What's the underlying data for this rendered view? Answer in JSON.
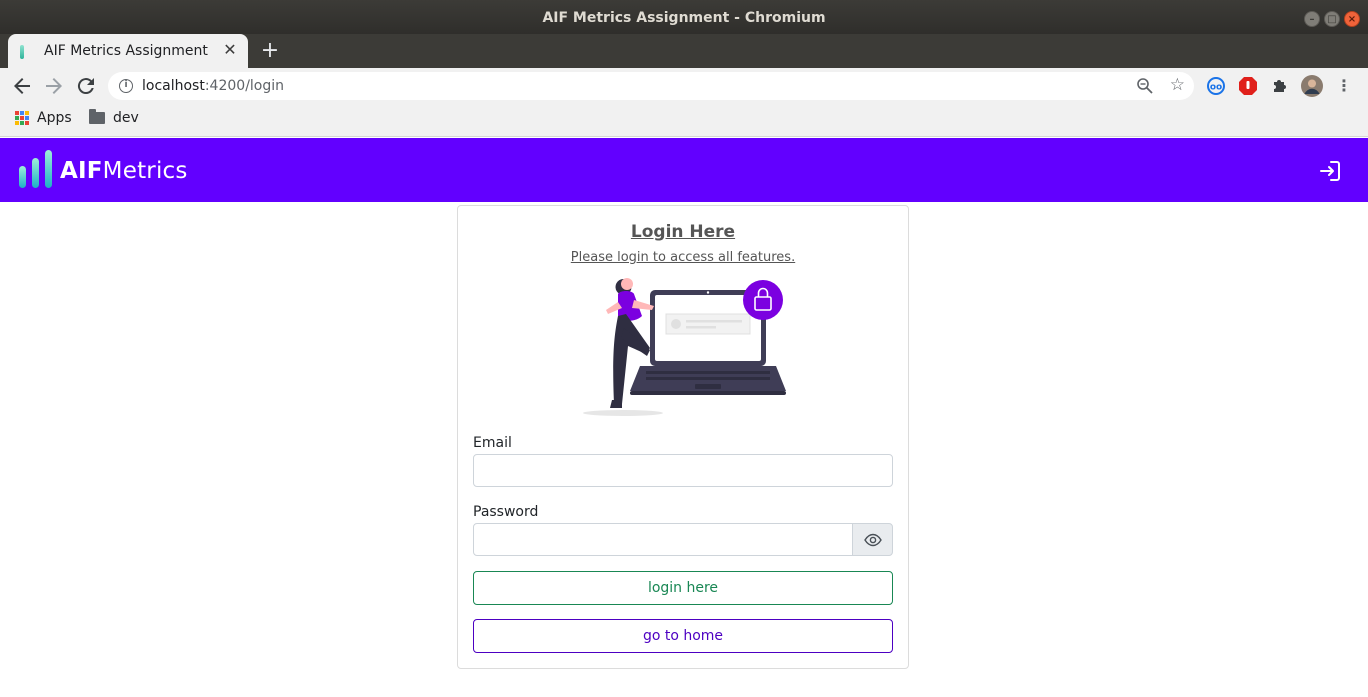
{
  "window": {
    "title": "AIF Metrics Assignment - Chromium"
  },
  "tab": {
    "title": "AIF Metrics Assignment",
    "close": "✕"
  },
  "toolbar": {
    "url_host": "localhost",
    "url_path": ":4200/login",
    "info": "i",
    "star": "☆",
    "menu": "⋮"
  },
  "bookmarks": [
    {
      "label": "Apps",
      "icon": "apps-grid-icon"
    },
    {
      "label": "dev",
      "icon": "folder-icon"
    }
  ],
  "colors": {
    "header_bg": "#6200ff",
    "login_btn": "#198754",
    "home_btn": "#4d00c2",
    "illustration_accent": "#7b00e0",
    "logo_gradient_top": "#9ff0d9",
    "logo_gradient_bottom": "#1db0c7"
  },
  "header": {
    "brand_bold": "AIF",
    "brand_light": "Metrics",
    "signin_icon": "sign-in-icon"
  },
  "login": {
    "title": "Login Here",
    "subtitle": "Please login to access all features.",
    "email_label": "Email",
    "email_value": "",
    "password_label": "Password",
    "password_value": "",
    "eye_icon": "eye-icon",
    "login_button": "login here",
    "home_button": "go to home"
  }
}
